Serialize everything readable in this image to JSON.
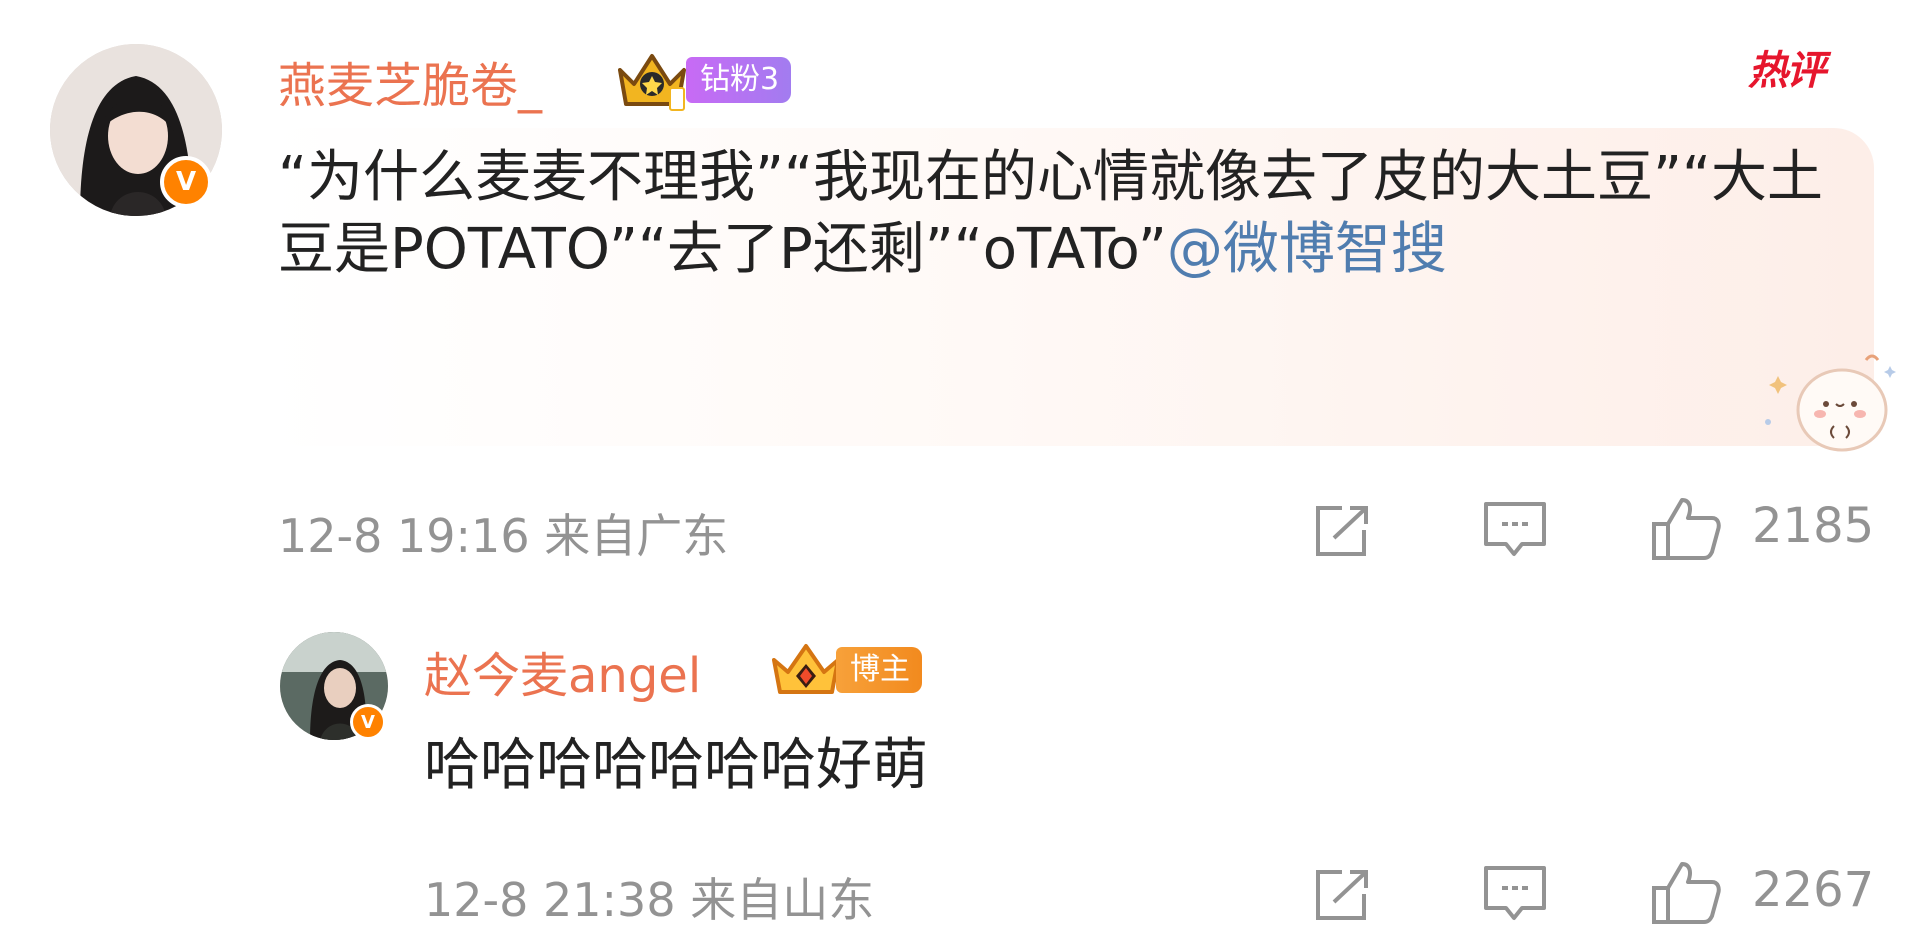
{
  "hot_tag": "热评",
  "comment": {
    "username": "燕麦芝脆卷_",
    "fan_badge": "钻粉3",
    "text_main": "“为什么麦麦不理我”“我现在的心情就像去了皮的大土豆”“大土豆是POTATO”“去了P还剩”“oTATo”",
    "mention": "@微博智搜",
    "meta": "12-8 19:16 来自广东",
    "likes": "2185"
  },
  "reply": {
    "username": "赵今麦angel",
    "fan_badge": "博主",
    "text": "哈哈哈哈哈哈哈好萌",
    "meta": "12-8 21:38 来自山东",
    "likes": "2267"
  },
  "colors": {
    "username": "#eb7350",
    "mention": "#507daf",
    "meta": "#939393",
    "vip_orange": "#ff8200",
    "hot_red": "#e6162d",
    "badge_purple": "#b174f0",
    "badge_orange": "#f59a23"
  },
  "icons": [
    "verified-v-icon",
    "crown-icon",
    "share-icon",
    "comment-icon",
    "like-icon"
  ]
}
